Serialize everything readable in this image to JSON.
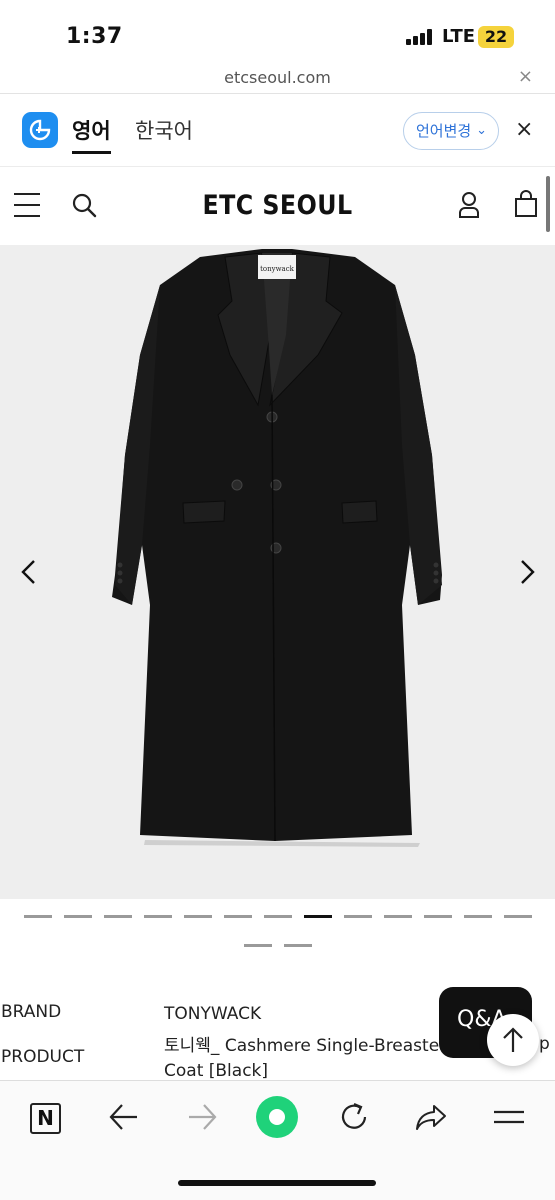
{
  "status_bar": {
    "time": "1:37",
    "network": "LTE",
    "battery": "22"
  },
  "url_bar": {
    "url": "etcseoul.com",
    "close": "×"
  },
  "translate_bar": {
    "tab_english": "영어",
    "tab_korean": "한국어",
    "change_language": "언어변경",
    "chevron": "⌄",
    "close": "×"
  },
  "header": {
    "logo": "ETC SEOUL"
  },
  "carousel": {
    "total_slides": 15,
    "active_slide": 8,
    "label_tag": "tonywack"
  },
  "product_info": {
    "brand_label": "BRAND",
    "brand_value": "TONYWACK",
    "product_label": "PRODUCT",
    "product_value_line1": "토니웩_ Cashmere Single-Breasted T",
    "product_value_line2": "Coat [Black]",
    "product_value_tail": "p"
  },
  "overlay": {
    "qna_label": "Q&A"
  },
  "colors": {
    "accent_blue": "#2f73d8",
    "translate_logo": "#1e8ef0",
    "green_button": "#1fd27a",
    "battery": "#f5d33c"
  }
}
